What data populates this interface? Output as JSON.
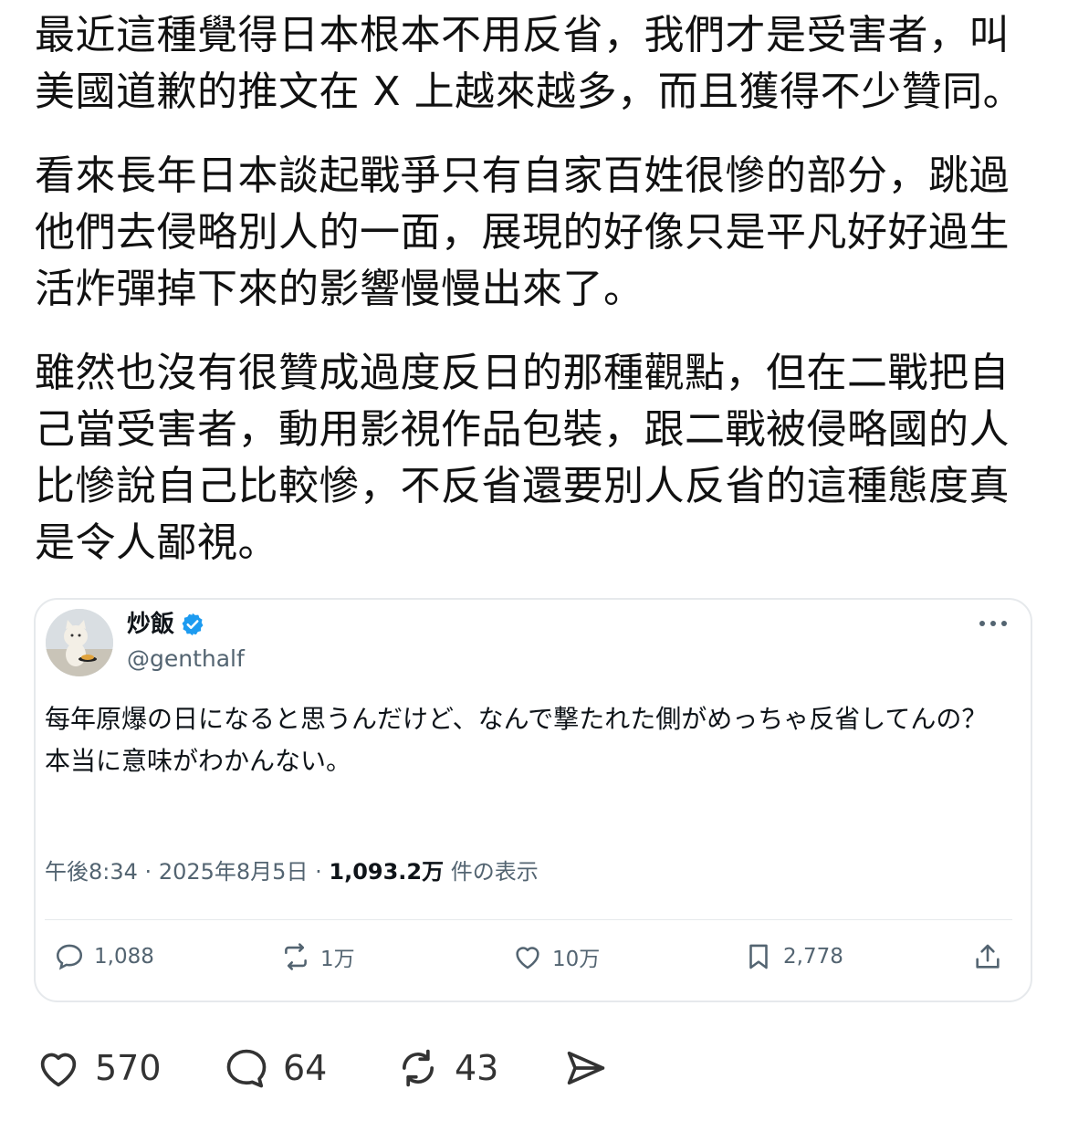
{
  "post": {
    "paragraphs": [
      "最近這種覺得日本根本不用反省，我們才是受害者，叫美國道歉的推文在 X 上越來越多，而且獲得不少贊同。",
      "看來長年日本談起戰爭只有自家百姓很慘的部分，跳過他們去侵略別人的一面，展現的好像只是平凡好好過生活炸彈掉下來的影響慢慢出來了。",
      "雖然也沒有很贊成過度反日的那種觀點，但在二戰把自己當受害者，動用影視作品包裝，跟二戰被侵略國的人比慘說自己比較慘，不反省還要別人反省的這種態度真是令人鄙視。"
    ]
  },
  "quote": {
    "display_name": "炒飯",
    "handle": "@genthalf",
    "text": "每年原爆の日になると思うんだけど、なんで撃たれた側がめっちゃ反省してんの？\n本当に意味がわかんない。",
    "time": "午後8:34",
    "date": "2025年8月5日",
    "views": "1,093.2万",
    "views_label": "件の表示",
    "sep": "·",
    "actions": {
      "replies": "1,088",
      "reposts": "1万",
      "likes": "10万",
      "bookmarks": "2,778"
    },
    "icons": {
      "verified": "verified-badge-icon",
      "more": "more-icon",
      "reply": "reply-icon",
      "repost": "repost-icon",
      "like": "heart-icon",
      "bookmark": "bookmark-icon",
      "share": "share-icon"
    }
  },
  "footer": {
    "likes": "570",
    "comments": "64",
    "reposts": "43"
  },
  "colors": {
    "verified": "#1d9bf0",
    "secondary_text": "#536471",
    "border": "#e6e9ec"
  }
}
